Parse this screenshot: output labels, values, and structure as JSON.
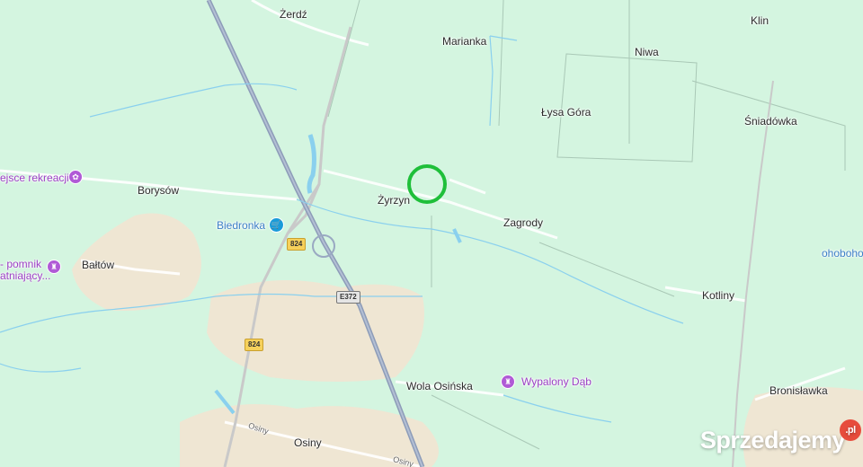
{
  "map": {
    "places": {
      "zerdz": "Żerdź",
      "marianka": "Marianka",
      "klin": "Klin",
      "niwa": "Niwa",
      "lysa_gora": "Łysa Góra",
      "sniadowka": "Śniadówka",
      "borysow": "Borysów",
      "zyrzyn": "Żyrzyn",
      "zagrody": "Zagrody",
      "baltow": "Bałtów",
      "kotliny": "Kotliny",
      "wola_osinska": "Wola Osińska",
      "bronislawka": "Bronisławka",
      "osiny": "Osiny",
      "osiny_road": "Osiny",
      "osiny_road2": "Osiny"
    },
    "pois": {
      "miejsce_rekreacji": "ejsce rekreacji",
      "biedronka": "Biedronka",
      "pomnik_line1": "- pomnik",
      "pomnik_line2": "atniający...",
      "wypalony_dab": "Wypalony Dąb",
      "edge_label": "ohoboho"
    },
    "roads": {
      "r824_a": "824",
      "r824_b": "824",
      "e372": "E372"
    },
    "colors": {
      "land": "#d4f5e0",
      "forest": "#c8f0d2",
      "farmland": "#efe3cf",
      "expressway": "#8d9cb8",
      "water": "#8ad0ee",
      "marker": "#1fbf3a"
    }
  },
  "watermark": {
    "brand": "Sprzedajemy",
    "badge": ".pl"
  }
}
